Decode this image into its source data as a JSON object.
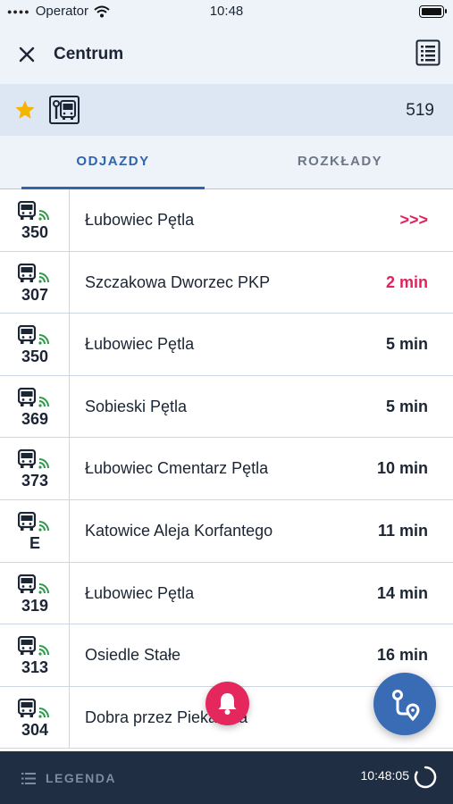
{
  "statusbar": {
    "carrier": "Operator",
    "time": "10:48"
  },
  "header": {
    "title": "Centrum",
    "close_icon": "close-icon",
    "list_icon": "timetable-list-icon"
  },
  "stop": {
    "favorite_icon": "star-icon",
    "stop_icon": "bus-stop-icon",
    "code": "519"
  },
  "tabs": [
    {
      "label": "ODJAZDY",
      "active": true
    },
    {
      "label": "ROZKŁADY",
      "active": false
    }
  ],
  "departures": [
    {
      "line": "350",
      "destination": "Łubowiec Pętla",
      "time": ">>>",
      "highlight": true
    },
    {
      "line": "307",
      "destination": "Szczakowa Dworzec PKP",
      "time": "2 min",
      "highlight": true
    },
    {
      "line": "350",
      "destination": "Łubowiec Pętla",
      "time": "5 min",
      "highlight": false
    },
    {
      "line": "369",
      "destination": "Sobieski Pętla",
      "time": "5 min",
      "highlight": false
    },
    {
      "line": "373",
      "destination": "Łubowiec Cmentarz Pętla",
      "time": "10 min",
      "highlight": false
    },
    {
      "line": "E",
      "destination": "Katowice Aleja Korfantego",
      "time": "11 min",
      "highlight": false
    },
    {
      "line": "319",
      "destination": "Łubowiec Pętla",
      "time": "14 min",
      "highlight": false
    },
    {
      "line": "313",
      "destination": "Osiedle Stałe",
      "time": "16 min",
      "highlight": false
    },
    {
      "line": "304",
      "destination": "Dobra przez Piekarska",
      "time": "",
      "highlight": false
    }
  ],
  "fabs": {
    "alert_icon": "bell-icon",
    "route_icon": "route-icon"
  },
  "bottombar": {
    "legend_label": "LEGENDA",
    "clock": "10:48:05"
  },
  "colors": {
    "accent": "#2f64ae",
    "alert": "#e2225c",
    "realtime": "#2e9b4a",
    "bottombar": "#1f2e43"
  }
}
